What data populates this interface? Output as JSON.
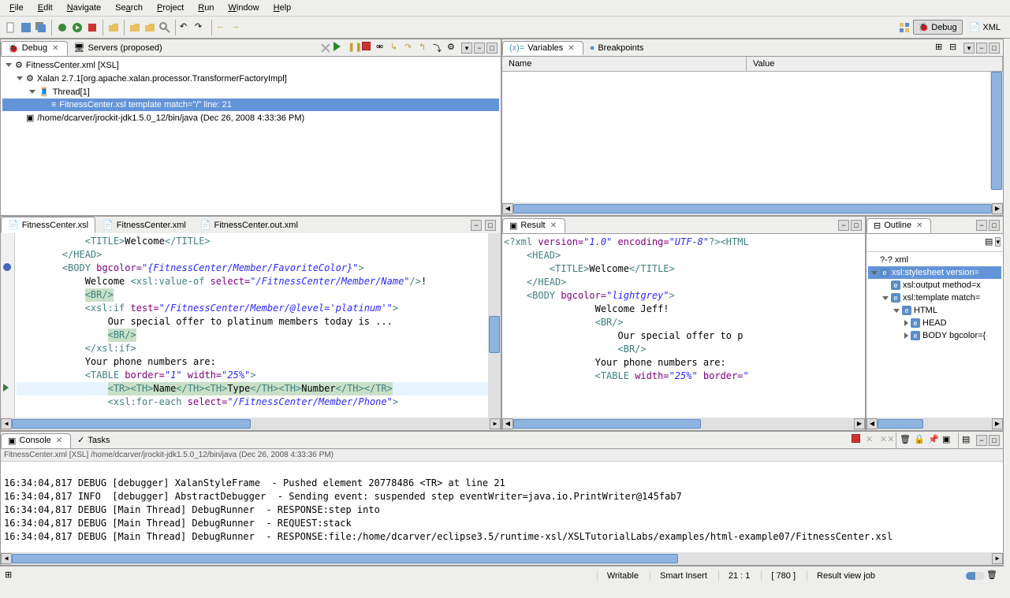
{
  "menu": {
    "file": "File",
    "edit": "Edit",
    "navigate": "Navigate",
    "search": "Search",
    "project": "Project",
    "run": "Run",
    "window": "Window",
    "help": "Help"
  },
  "perspectives": {
    "debug": "Debug",
    "xml": "XML"
  },
  "debug_view": {
    "tab": "Debug",
    "servers_tab": "Servers (proposed)",
    "root": "FitnessCenter.xml [XSL]",
    "xalan": "Xalan 2.7.1[org.apache.xalan.processor.TransformerFactoryImpl]",
    "thread": "Thread[1]",
    "frame": "FitnessCenter.xsl template match=\"/\" line: 21",
    "terminated": "/home/dcarver/jrockit-jdk1.5.0_12/bin/java (Dec 26, 2008 4:33:36 PM)"
  },
  "variables_view": {
    "tab": "Variables",
    "breakpoints_tab": "Breakpoints",
    "col_name": "Name",
    "col_value": "Value"
  },
  "editor": {
    "tabs": {
      "xsl": "FitnessCenter.xsl",
      "xml": "FitnessCenter.xml",
      "outxml": "FitnessCenter.out.xml"
    }
  },
  "result_view": {
    "tab": "Result"
  },
  "outline_view": {
    "tab": "Outline",
    "xml": "xml",
    "stylesheet": "xsl:stylesheet version=",
    "output": "xsl:output method=x",
    "template": "xsl:template match=",
    "html": "HTML",
    "head": "HEAD",
    "body": "BODY bgcolor={"
  },
  "console_view": {
    "tab": "Console",
    "tasks_tab": "Tasks",
    "title": "FitnessCenter.xml [XSL] /home/dcarver/jrockit-jdk1.5.0_12/bin/java (Dec 26, 2008 4:33:36 PM)",
    "lines": [
      "16:34:04,817 DEBUG [debugger] XalanStyleFrame  - Pushed element 20778486 <TR> at line 21",
      "16:34:04,817 INFO  [debugger] AbstractDebugger  - Sending event: suspended step eventWriter=java.io.PrintWriter@145fab7",
      "16:34:04,817 DEBUG [Main Thread] DebugRunner  - RESPONSE:step into",
      "16:34:04,817 DEBUG [Main Thread] DebugRunner  - REQUEST:stack",
      "16:34:04,817 DEBUG [Main Thread] DebugRunner  - RESPONSE:file:/home/dcarver/eclipse3.5/runtime-xsl/XSLTutorialLabs/examples/html-example07/FitnessCenter.xsl"
    ]
  },
  "statusbar": {
    "writable": "Writable",
    "insert": "Smart Insert",
    "pos": "21 : 1",
    "count": "[ 780 ]",
    "job": "Result view job"
  }
}
